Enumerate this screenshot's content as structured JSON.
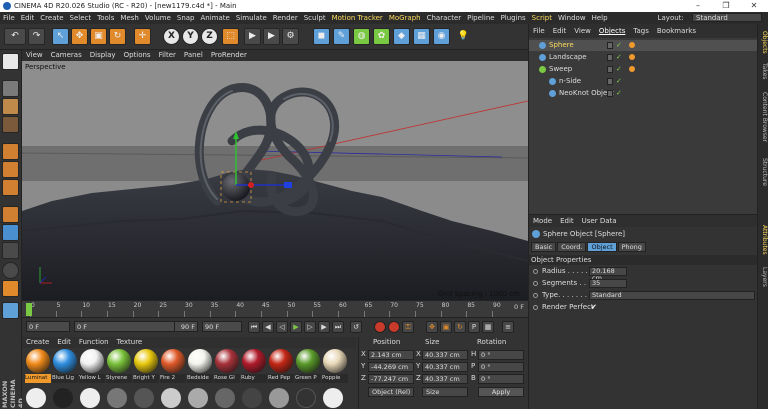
{
  "window": {
    "title": "CINEMA 4D R20.026 Studio (RC - R20) - [new1179.c4d *] - Main",
    "minimize": "–",
    "maximize": "❐",
    "close": "✕"
  },
  "menubar": {
    "items": [
      "File",
      "Edit",
      "Create",
      "Select",
      "Tools",
      "Mesh",
      "Volume",
      "Snap",
      "Animate",
      "Simulate",
      "Render",
      "Sculpt",
      "Motion Tracker",
      "MoGraph",
      "Character",
      "Pipeline",
      "Plugins",
      "Script",
      "Window",
      "Help"
    ],
    "layout_label": "Layout:",
    "layout_value": "Standard"
  },
  "toolbar": {
    "undo": "↶",
    "redo": "↷",
    "x": "X",
    "y": "Y",
    "z": "Z"
  },
  "viewport": {
    "menu": [
      "View",
      "Cameras",
      "Display",
      "Options",
      "Filter",
      "Panel",
      "ProRender"
    ],
    "label": "Perspective",
    "grid_spacing": "Grid Spacing : 1000 cm",
    "background": "#8b8b8b"
  },
  "timeline": {
    "ticks": [
      "0",
      "5",
      "10",
      "15",
      "20",
      "25",
      "30",
      "35",
      "40",
      "45",
      "50",
      "55",
      "60",
      "65",
      "70",
      "75",
      "80",
      "85",
      "90"
    ],
    "end_label": "0 F"
  },
  "playback": {
    "current_frame": "0 F",
    "min_frame": "0 F",
    "max_frame_a": "90 F",
    "max_frame_b": "90 F"
  },
  "materials": {
    "menu": [
      "Create",
      "Edit",
      "Function",
      "Texture"
    ],
    "items": [
      {
        "label": "Luminat",
        "color": "#f08a1a",
        "selected": true
      },
      {
        "label": "Blue Lig",
        "color": "#2f8fe0",
        "selected": false
      },
      {
        "label": "Yellow L",
        "color": "#f2f2f2",
        "selected": false
      },
      {
        "label": "Styrene",
        "color": "#7ac23a",
        "selected": false
      },
      {
        "label": "Bright Y",
        "color": "#e8c80e",
        "selected": false
      },
      {
        "label": "Fire 2",
        "color": "#e05a2a",
        "selected": false
      },
      {
        "label": "Bedside",
        "color": "#f4f4ee",
        "selected": false
      },
      {
        "label": "Rose Gl",
        "color": "#a8323a",
        "selected": false
      },
      {
        "label": "Ruby",
        "color": "#b01a2a",
        "selected": false
      },
      {
        "label": "Red Pep",
        "color": "#c42616",
        "selected": false
      },
      {
        "label": "Green P",
        "color": "#5a9a2a",
        "selected": false
      },
      {
        "label": "Poppie",
        "color": "#e8d8b8",
        "selected": false
      }
    ]
  },
  "coordinates": {
    "headers": [
      "Position",
      "Size",
      "Rotation"
    ],
    "rows": [
      {
        "axis": "X",
        "pos": "2.143 cm",
        "size_axis": "X",
        "size": "40.337 cm",
        "rot_axis": "H",
        "rot": "0 °"
      },
      {
        "axis": "Y",
        "pos": "-44.269 cm",
        "size_axis": "Y",
        "size": "40.337 cm",
        "rot_axis": "P",
        "rot": "0 °"
      },
      {
        "axis": "Z",
        "pos": "-77.247 cm",
        "size_axis": "Z",
        "size": "40.337 cm",
        "rot_axis": "B",
        "rot": "0 °"
      }
    ],
    "mode": "Object (Rel)",
    "size_mode": "Size",
    "apply": "Apply"
  },
  "object_manager": {
    "menu": [
      "File",
      "Edit",
      "View",
      "Objects",
      "Tags",
      "Bookmarks"
    ],
    "objects": [
      {
        "name": "Sphere",
        "color": "#5fa0d8",
        "selected": true,
        "indent": 0,
        "name_color": "#ffdc5e"
      },
      {
        "name": "Landscape",
        "color": "#5fa0d8",
        "selected": false,
        "indent": 0,
        "name_color": "#ddd"
      },
      {
        "name": "Sweep",
        "color": "#7ac943",
        "selected": false,
        "indent": 0,
        "name_color": "#ddd"
      },
      {
        "name": "n-Side",
        "color": "#5fa0d8",
        "selected": false,
        "indent": 1,
        "name_color": "#ddd"
      },
      {
        "name": "NeoKnot Object",
        "color": "#5fa0d8",
        "selected": false,
        "indent": 1,
        "name_color": "#ddd"
      }
    ]
  },
  "attributes": {
    "menu": [
      "Mode",
      "Edit",
      "User Data"
    ],
    "title": "Sphere Object [Sphere]",
    "tabs": [
      "Basic",
      "Coord.",
      "Object",
      "Phong"
    ],
    "active_tab": "Object",
    "section": "Object Properties",
    "radius_label": "Radius . . . . . .",
    "radius": "20.168 cm",
    "segments_label": "Segments . . .",
    "segments": "35",
    "type_label": "Type. . . . . . . . .",
    "type": "Standard",
    "render_perfect_label": "Render Perfect",
    "render_perfect": "✔"
  },
  "right_tabs": [
    "Objects",
    "Takes",
    "Content Browser",
    "Structure",
    "Attributes",
    "Layers"
  ],
  "brand": "MAXON CINEMA 4D"
}
